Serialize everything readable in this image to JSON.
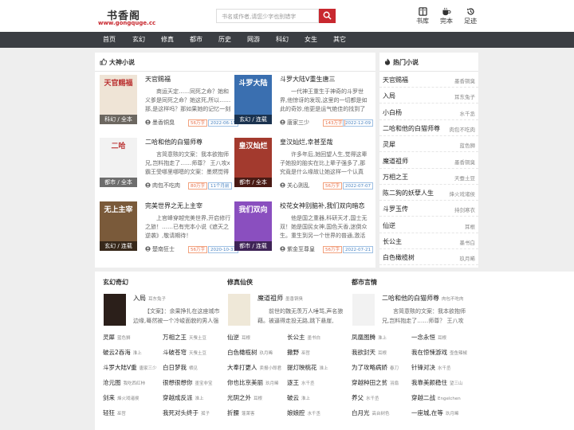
{
  "header": {
    "logo_title": "书香阁",
    "logo_url": "www.gongquge.cc",
    "search_placeholder": "书名或作者,请您少字也别错字",
    "icons": [
      {
        "name": "bookshelf-icon",
        "label": "书库"
      },
      {
        "name": "coffee-icon",
        "label": "完本"
      },
      {
        "name": "history-icon",
        "label": "足迹"
      }
    ]
  },
  "nav": [
    "首页",
    "玄幻",
    "修真",
    "都市",
    "历史",
    "网游",
    "科幻",
    "女生",
    "其它"
  ],
  "featured": {
    "title": "大神小说",
    "books": [
      {
        "title": "天官赐福",
        "desc": "商运天定……同死之命？她和义爹是同死之命？她这死,所以……那,是这样吗？那如果她的记忆一刻",
        "author": "墨香铜臭",
        "words": "56万字",
        "date": "2022-06-15",
        "tag": "科幻 / 全本",
        "cover_bg": "#efe4d6",
        "cover_text": "天官赐福"
      },
      {
        "title": "斗罗大陆V重生唐三",
        "desc": "一代神王重生于神奇的斗罗世界,他惊讶的发现,这里的一切都是如此的奇妙,他更是运气绝佳的找到了",
        "author": "唐家三少",
        "words": "143万字",
        "date": "2022-12-09",
        "tag": "玄幻 / 连载",
        "cover_bg": "#3a6fb0",
        "cover_text": "斗罗大陆"
      },
      {
        "title": "二哈和他的白猫师尊",
        "desc": "言简意赅的文案：我本欲抱师兄,岂料抱走了……师尊？ 王八攻x霸王受哪里哪嗯的文案：墨燃觉得",
        "author": "肉包不吃肉",
        "words": "80万字",
        "date": "11个月前",
        "tag": "都市 / 全本",
        "cover_bg": "#f2f2f2",
        "cover_text": "二哈"
      },
      {
        "title": "皇汉灿烂,幸甚至哉",
        "desc": "许多年后,她回望人生,觉得这辈子她投的胎实在比上辈子强多了,那究竟是什么缘故让她这样一个认真",
        "author": "关心则乱",
        "words": "56万字",
        "date": "2022-07-07",
        "tag": "都市 / 全本",
        "cover_bg": "#a33a2e",
        "cover_text": "皇汉灿烂"
      },
      {
        "title": "完美世界之无上主宰",
        "desc": "上官峰穿越完美世界,开启修行之旅！……已有完本小说《遮天之逆袭》,敬请期待！",
        "author": "楚南狂士",
        "words": "56万字",
        "date": "2020-10-31",
        "tag": "玄幻 / 连载",
        "cover_bg": "#7a5a3a",
        "cover_text": "无上主宰"
      },
      {
        "title": "校花女神别脑补,我们双向暗恋",
        "desc": "他是国之重器,科研天才,国士无双！她是国民女神,国色天香,迷倒众生。重生到另一个世界的普通,激活",
        "author": "紫金至尊皇",
        "words": "56万字",
        "date": "2022-07-21",
        "tag": "都市 / 连载",
        "cover_bg": "#8a4fbf",
        "cover_text": "我们双向"
      }
    ]
  },
  "hot": {
    "title": "热门小说",
    "items": [
      {
        "name": "天官赐福",
        "author": "墨香铜臭"
      },
      {
        "name": "入局",
        "author": "耳东兔子"
      },
      {
        "name": "小白杨",
        "author": "水千丞"
      },
      {
        "name": "二哈和他的白猫师尊",
        "author": "肉包不吃肉"
      },
      {
        "name": "灵犀",
        "author": "蓝色狮"
      },
      {
        "name": "魔道祖师",
        "author": "墨香铜臭"
      },
      {
        "name": "万相之王",
        "author": "天蚕土豆"
      },
      {
        "name": "陈二狗的妖孽人生",
        "author": "烽火戏诸侯"
      },
      {
        "name": "斗罗玉传",
        "author": "持剑寒衣"
      },
      {
        "name": "仙逆",
        "author": "耳根"
      },
      {
        "name": "长公主",
        "author": "墨书白"
      },
      {
        "name": "白色橄榄树",
        "author": "玖月晞"
      }
    ]
  },
  "sections": [
    {
      "title": "玄幻奇幻",
      "feat": {
        "title": "入局",
        "author": "耳东兔子",
        "desc": "【文案】：余果挣扎在这座城市边缘,蓦然被一个冷峻面貌的男人强",
        "cover_bg": "#2b1f1a"
      },
      "items": [
        {
          "name": "灵犀",
          "author": "蓝色狮"
        },
        {
          "name": "万相之王",
          "author": "天蚕土豆"
        },
        {
          "name": "破云2吞海",
          "author": "淮上"
        },
        {
          "name": "斗破苍穹",
          "author": "天蚕土豆"
        },
        {
          "name": "斗罗大陆V重",
          "author": "唐家三少"
        },
        {
          "name": "白日梦我",
          "author": "栖见"
        },
        {
          "name": "沧元图",
          "author": "我吃西红柿"
        },
        {
          "name": "很想很想你",
          "author": "墨宝非宝"
        },
        {
          "name": "剑来",
          "author": "烽火戏诸侯"
        },
        {
          "name": "穿越成反派",
          "author": "淮上"
        },
        {
          "name": "轻狂",
          "author": "巫哲"
        },
        {
          "name": "我死对头终于",
          "author": "孤子"
        }
      ]
    },
    {
      "title": "修真仙侠",
      "feat": {
        "title": "魔道祖师",
        "author": "墨香铜臭",
        "desc": "前世的魏无羡万人唾骂,声名狼藉。被逼得走投无路,跳下悬崖,",
        "cover_bg": "#efe8d8"
      },
      "items": [
        {
          "name": "仙逆",
          "author": "耳根"
        },
        {
          "name": "长公主",
          "author": "墨书白"
        },
        {
          "name": "白色橄榄树",
          "author": "玖月晞"
        },
        {
          "name": "撒野",
          "author": "巫哲"
        },
        {
          "name": "大奉打更人",
          "author": "卖报小郎君"
        },
        {
          "name": "提灯映桃花",
          "author": "淮上"
        },
        {
          "name": "你也比京美丽",
          "author": "玖月晞"
        },
        {
          "name": "逐王",
          "author": "水千丞"
        },
        {
          "name": "光阴之外",
          "author": "耳根"
        },
        {
          "name": "破云",
          "author": "淮上"
        },
        {
          "name": "折腰",
          "author": "蓬莱客"
        },
        {
          "name": "娘娘腔",
          "author": "水千丞"
        }
      ]
    },
    {
      "title": "都市言情",
      "feat": {
        "title": "二哈和他的白猫师尊",
        "author": "肉包不吃肉",
        "desc": "言简意赅的文案：我本欲抱师兄,岂料抱走了……师尊？ 王八攻",
        "cover_bg": "#f2f2f2"
      },
      "items": [
        {
          "name": "凤凰图腾",
          "author": "淮上"
        },
        {
          "name": "一念永恒",
          "author": "耳根"
        },
        {
          "name": "我欲封天",
          "author": "耳根"
        },
        {
          "name": "我在惊悚游戏",
          "author": "壶鱼辣椒"
        },
        {
          "name": "为了攻略病娇",
          "author": "春刀"
        },
        {
          "name": "针锋对决",
          "author": "水千丞"
        },
        {
          "name": "穿越种田之贫",
          "author": "羽扇"
        },
        {
          "name": "我靠美颜稳住",
          "author": "望三山"
        },
        {
          "name": "养父",
          "author": "水千丞"
        },
        {
          "name": "穿越二战",
          "author": "Engelchen"
        },
        {
          "name": "白月光",
          "author": "高台树色"
        },
        {
          "name": "一座城,在等",
          "author": "玖月晞"
        }
      ]
    }
  ],
  "colors": {
    "brand_red": "#c8282f",
    "nav_bg": "#3b3e43",
    "page_bg": "#eeeeee"
  }
}
